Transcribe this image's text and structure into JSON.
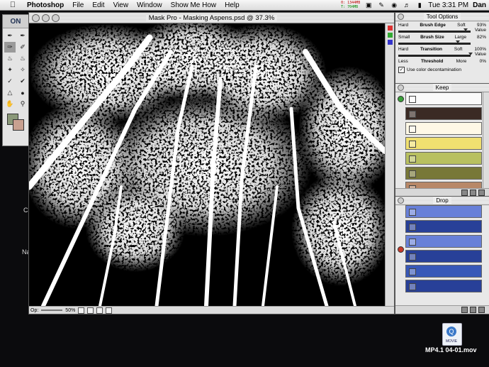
{
  "menubar": {
    "app": "Photoshop",
    "items": [
      "File",
      "Edit",
      "View",
      "Window",
      "Show Me How",
      "Help"
    ],
    "meter_top": "0: 1344MB",
    "meter_bottom": "T: 704MB",
    "clock": "Tue 3:31 PM",
    "user": "Dan"
  },
  "toolbox": {
    "logo": "ON"
  },
  "document": {
    "title": "Mask Pro - Masking Aspens.psd @ 37.3%",
    "status_label": "Op:",
    "status_zoom": "50%"
  },
  "tool_options": {
    "title": "Tool Options",
    "brush_edge": {
      "left": "Hard",
      "label": "Brush Edge",
      "right": "Soft",
      "value": "93%",
      "fraction": 0.93
    },
    "value_label_1": "Value",
    "brush_size": {
      "left": "Small",
      "label": "Brush Size",
      "right": "Large",
      "value": "82%",
      "fraction": 0.82
    },
    "transition": {
      "left": "Hard",
      "label": "Transition",
      "right": "Soft",
      "value": "100%",
      "fraction": 1.0
    },
    "value_label_2": "Value",
    "threshold": {
      "left": "Less",
      "label": "Threshold",
      "right": "More",
      "value": "0%",
      "fraction": 0.0
    },
    "decontam_label": "Use color decontamination",
    "decontam_checked": true
  },
  "keep": {
    "title": "Keep",
    "colors": [
      "#fafafa",
      "#3a2a24",
      "#fff8e6",
      "#f0e070",
      "#b8c060",
      "#787838",
      "#b88868"
    ]
  },
  "drop": {
    "title": "Drop",
    "colors": [
      "#6880d8",
      "#284098",
      "#6880d8",
      "#284098",
      "#3858b8",
      "#284098"
    ]
  },
  "desktop": {
    "file_name": "MP4.1 04-01.mov",
    "file_badge": "MOVIE",
    "left_text_1": "C",
    "left_text_2": "Na"
  },
  "colors": {
    "fg_swatch": "#8a9878",
    "bg_swatch": "#c8a090",
    "keep_indicator": "#3aa03a",
    "drop_indicator": "#c83a28"
  }
}
